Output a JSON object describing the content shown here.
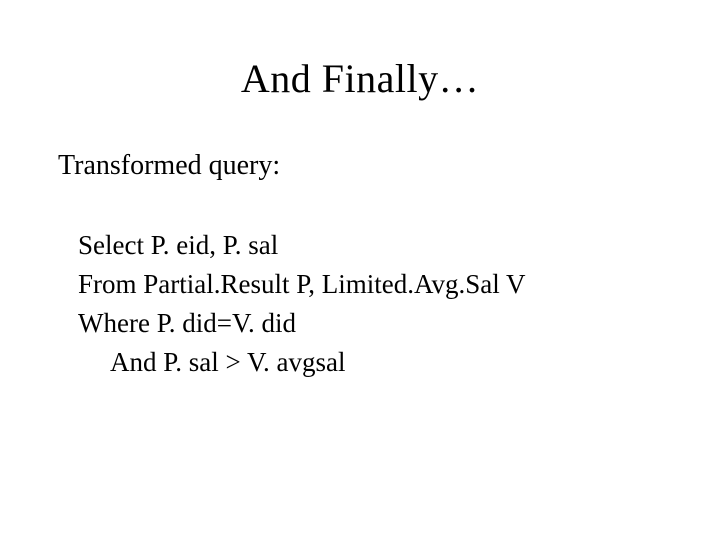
{
  "title": "And Finally…",
  "subtitle": "Transformed query:",
  "query": {
    "line1": "Select  P. eid, P. sal",
    "line2": "From  Partial.Result P,  Limited.Avg.Sal V",
    "line3": "Where P. did=V. did",
    "line4": "And  P. sal > V. avgsal"
  }
}
